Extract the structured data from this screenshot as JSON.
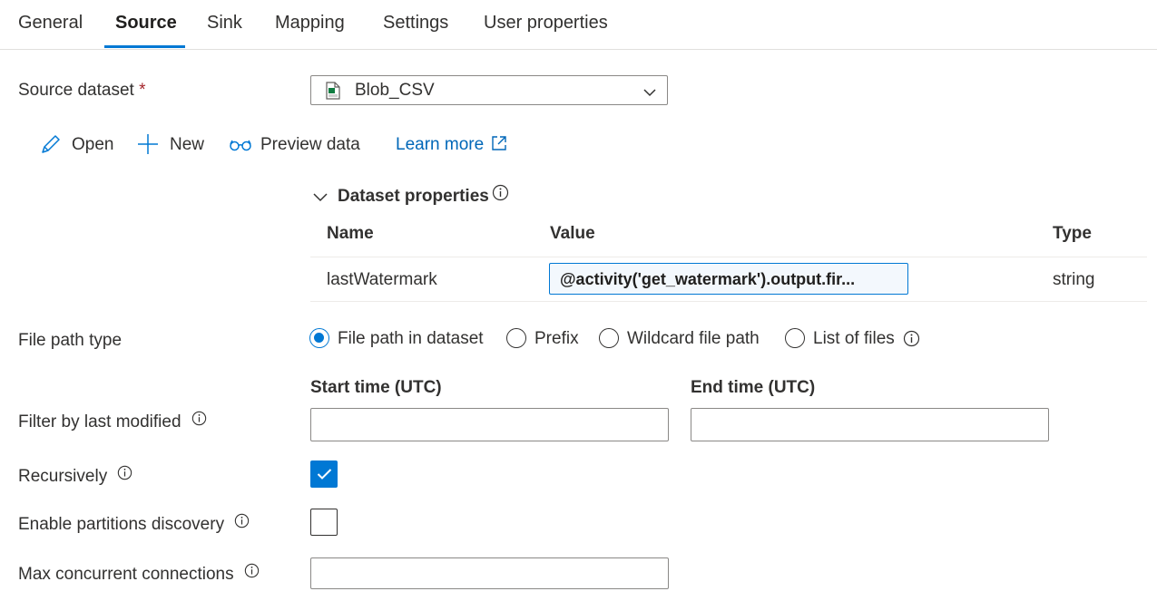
{
  "tabs": [
    {
      "label": "General"
    },
    {
      "label": "Source",
      "active": true
    },
    {
      "label": "Sink"
    },
    {
      "label": "Mapping"
    },
    {
      "label": "Settings"
    },
    {
      "label": "User properties"
    }
  ],
  "source_dataset": {
    "label": "Source dataset",
    "required_mark": "*",
    "selected": "Blob_CSV",
    "icon": "csv-file-icon"
  },
  "actions": {
    "open": "Open",
    "new": "New",
    "preview": "Preview data",
    "learn_more": "Learn more"
  },
  "dataset_properties": {
    "title": "Dataset properties",
    "headers": {
      "name": "Name",
      "value": "Value",
      "type": "Type"
    },
    "rows": [
      {
        "name": "lastWatermark",
        "value": "@activity('get_watermark').output.fir...",
        "type": "string"
      }
    ]
  },
  "file_path_type": {
    "label": "File path type",
    "options": [
      "File path in dataset",
      "Prefix",
      "Wildcard file path",
      "List of files"
    ],
    "selected": "File path in dataset"
  },
  "filter_last_modified": {
    "label": "Filter by last modified",
    "start_label": "Start time (UTC)",
    "end_label": "End time (UTC)",
    "start_value": "",
    "end_value": ""
  },
  "recursively": {
    "label": "Recursively",
    "checked": true
  },
  "partitions": {
    "label": "Enable partitions discovery",
    "checked": false
  },
  "max_connections": {
    "label": "Max concurrent connections",
    "value": ""
  },
  "colors": {
    "accent": "#0078d4",
    "link": "#0067b8",
    "required": "#a4262c"
  }
}
